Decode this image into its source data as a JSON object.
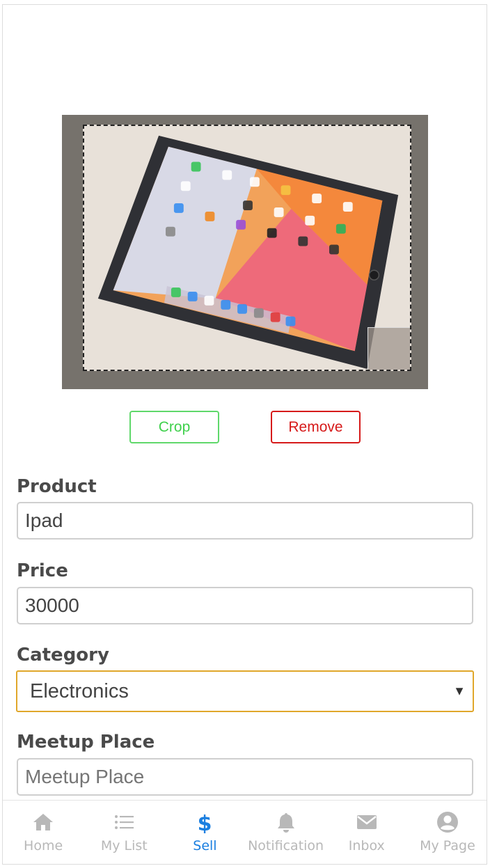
{
  "image_editor": {
    "crop_label": "Crop",
    "remove_label": "Remove"
  },
  "form": {
    "product": {
      "label": "Product",
      "value": "Ipad"
    },
    "price": {
      "label": "Price",
      "value": "30000"
    },
    "category": {
      "label": "Category",
      "selected": "Electronics"
    },
    "meetup": {
      "label": "Meetup Place",
      "placeholder": "Meetup Place",
      "value": ""
    }
  },
  "bottom_nav": {
    "items": [
      {
        "label": "Home",
        "icon": "home-icon"
      },
      {
        "label": "My List",
        "icon": "list-icon"
      },
      {
        "label": "Sell",
        "icon": "dollar-icon",
        "active": true
      },
      {
        "label": "Notification",
        "icon": "bell-icon"
      },
      {
        "label": "Inbox",
        "icon": "mail-icon"
      },
      {
        "label": "My Page",
        "icon": "user-icon"
      }
    ]
  },
  "colors": {
    "accent": "#1b7fe0",
    "crop": "#3fd04c",
    "remove": "#d61a1a",
    "select_border": "#e0a72a"
  }
}
